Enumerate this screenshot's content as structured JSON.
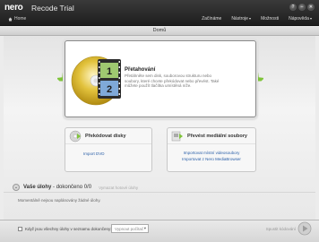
{
  "titlebar": {
    "logo": "nero",
    "app_title": "Recode Trial",
    "home": "Home",
    "menu": [
      "Začínáme",
      "Nástroje",
      "Možnosti",
      "Nápověda"
    ],
    "window_buttons": [
      "?",
      "–",
      "✕"
    ]
  },
  "tabbar": {
    "title": "Domů"
  },
  "feature": {
    "title": "Přetahování",
    "description": "Přetáhněte sem disk, souborovou strukturu nebo soubory, které chcete překódovat nebo převést. Také můžete použít tlačítka umístěná níže.",
    "disc_numbers": [
      "1",
      "2"
    ]
  },
  "cards": {
    "recode": {
      "title": "Překódovat disky",
      "links": [
        "Import DVD"
      ]
    },
    "convert": {
      "title": "Převést mediální soubory",
      "links": [
        "Importovat místní videosoubory",
        "Importovat z Nero MediaBrowser"
      ]
    }
  },
  "tasks": {
    "title_bold": "Vaše úlohy",
    "title_rest": " - dokončeno 0/0",
    "clear": "Vymazat hotové úlohy",
    "status": "Momentálně nejsou naplánovány žádné úlohy."
  },
  "bottom": {
    "checkbox_label": "Když jsou všechny úlohy v seznamu dokončeny:",
    "select_value": "Vypnout počítač",
    "start_label": "Spustit kódování"
  },
  "colors": {
    "accent_green": "#7fc43a",
    "link_blue": "#2a5fa8",
    "titlebar": "#2a2a2a"
  }
}
